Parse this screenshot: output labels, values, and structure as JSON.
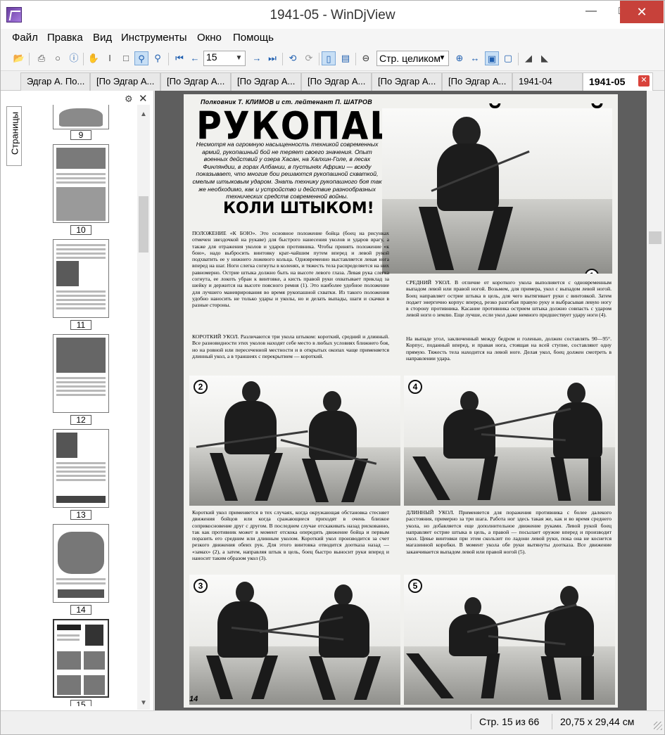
{
  "window": {
    "title": "1941-05 - WinDjView"
  },
  "menu": [
    "Файл",
    "Правка",
    "Вид",
    "Инструменты",
    "Окно",
    "Помощь"
  ],
  "toolbar": {
    "page_value": "15",
    "zoom_value": "Стр. целиком"
  },
  "tabs": [
    {
      "label": "Эдгар А. По..."
    },
    {
      "label": "[По Эдгар А..."
    },
    {
      "label": "[По Эдгар А..."
    },
    {
      "label": "[По Эдгар А..."
    },
    {
      "label": "[По Эдгар А..."
    },
    {
      "label": "[По Эдгар А..."
    },
    {
      "label": "[По Эдгар А..."
    },
    {
      "label": "1941-04"
    },
    {
      "label": "1941-05"
    }
  ],
  "sidebar": {
    "tab_label": "Страницы",
    "thumbnails": [
      "9",
      "10",
      "11",
      "12",
      "13",
      "14",
      "15"
    ]
  },
  "document": {
    "byline": "Полковник Т. КЛИМОВ и ст. лейтенант П. ШАТРОВ",
    "headline": "РУКОПАШНЫЙ БОЙ",
    "intro": "Несмотря на огромную насыщенность техникой современных армий, рукопашный бой не теряет своего значения. Опыт военных действий у озера Хасан, на Халхин-Голе, в лесах Финляндии, в горах Албании, в пустынях Африки — всюду показывает, что многие бои решаются рукопашной схваткой, смелым штыковым ударом. Знать технику рукопашного боя так же необходимо, как и устройство и действие разнообразных технических средств современной войны.",
    "subhead": "КОЛИ ШТЫКОМ!",
    "col1_p1": "ПОЛОЖЕНИЕ «К БОЮ». Это основное положение бойца (боец на рисунках отмечен звездочкой на рукаве) для быстрого нанесения уколов и ударов врагу, а также для отражения уколов и ударов противника. Чтобы принять положение «к бою», надо выбросить винтовку крат-чайшим путем вперед и левой рукой подхватить ее у нижнего ложевого кольца. Одновременно выставляется левая нога вперед на шаг. Ноги слегка согнуты в коленях, и тяжесть тела распределяется на них равномерно. Острие штыка должно быть на высоте левого глаза. Левая рука слегка согнута, ее локоть убран к винтовке, а кисть правой руки охватывает приклад за шейку и держится на высоте поясного ремня (1). Это наиболее удобное положение для лучшего маневрирования во время рукопашной схватки. Из такого положения удобно наносить не только удары и уколы, но и делать выпады, шаги и скачки в разные стороны.",
    "col1_p2": "КОРОТКИЙ УКОЛ. Различаются три укола штыком: короткий, средний и длинный. Все разновидности этих уколов находят себе место в любых условиях ближнего боя, но на ровной или пересеченной местности и в открытых окопах чаще применяется длинный укол, а в траншеях с перекрытием — короткий.",
    "col2_p1": "СРЕДНИЙ УКОЛ. В отличие от короткого укола выполняется с одновременным выпадом левой или правой ногой. Возьмем, для примера, укол с выпадом левой ногой. Боец направляет острие штыка в цель, для чего вытягивает руки с винтовкой. Затем подает энергично корпус вперед, резко разгибая правую руку и выбрасывая левую ногу в сторону противника. Касание противника острием штыка должно совпасть с ударом левой ноги о землю. Еще лучше, если укол даже немного предшествует удару ноги (4).",
    "col2_p2": "На выпаде угол, заключенный между бедром и голенью, должен составлять 90—95°. Корпус, поданный вперед, и правая нога, стоящая на всей ступне, составляют одну прямую. Тяжесть тела находится на левой ноге. Делая укол, боец должен смотреть в направлении удара.",
    "col1_p3": "Короткий укол применяется в тех случаях, когда окружающая обстановка стесняет движения бойцов или когда сражающиеся приходят в очень близкое соприкосновение друг с другом. В последнем случае отскакивать назад рискованно, так как противник может в момент отскока опередить движение бойца и первым поразить его средним или длинным уколом. Короткий укол производится за счет резкого движения обеих рук. Для этого винтовка отводится доотказа назад — «замах» (2), а затем, направляя штык в цель, боец быстро выносит руки вперед и наносит таким образом укол (3).",
    "col2_p3": "ДЛИННЫЙ УКОЛ. Применяется для поражения противника с более далекого расстояния, примерно за три шага. Работа ног здесь такая же, как и во время среднего укола, но добавляется еще дополнительное движение руками. Левой рукой боец направляет острие штыка в цель, а правой — посылает оружие вперед и производит укол. Цевье винтовки при этом скользит по ладони левой руки, пока она не коснется магазинной коробки. В момент укола обе руки вытянуты доотказа. Все движение заканчивается выпадом левой или правой ногой (5).",
    "photo_numbers": [
      "1",
      "2",
      "3",
      "4",
      "5"
    ],
    "page_number": "14"
  },
  "status": {
    "page": "Стр. 15 из 66",
    "size": "20,75 x 29,44 см"
  }
}
